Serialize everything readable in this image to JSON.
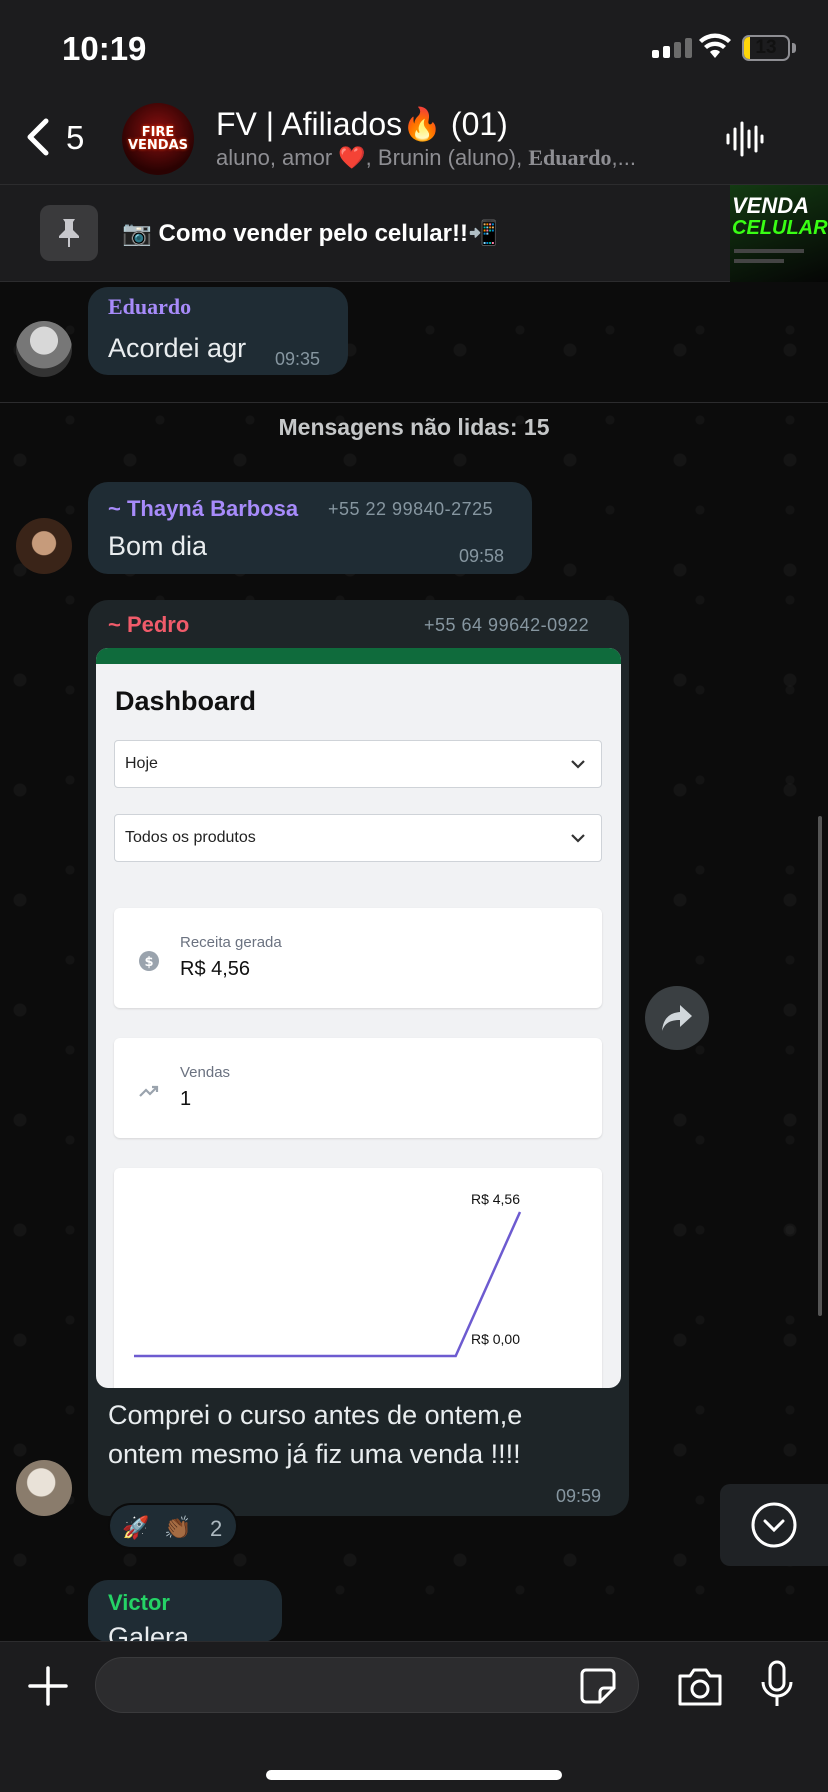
{
  "status_bar": {
    "time": "10:19",
    "battery": "13",
    "battery_level": 0.13,
    "battery_color": "#ffd60a"
  },
  "header": {
    "back_count": "5",
    "avatar_text_1": "FIRE",
    "avatar_text_2": "VENDAS",
    "title": "FV | Afiliados🔥 (01)",
    "members_prefix": "aluno, amor ❤️, Brunin (aluno), ",
    "members_bold": "Eduardo",
    "members_suffix": ",..."
  },
  "pinned": {
    "text": "📷 Como vender pelo celular!!📲",
    "thumb_line1": "VENDA",
    "thumb_line2": "CELULAR"
  },
  "messages": {
    "eduardo": {
      "sender": "Eduardo",
      "text": "Acordei agr",
      "time": "09:35",
      "color": "#a78bfa"
    },
    "unread_label": "Mensagens não lidas: 15",
    "thayna": {
      "sender": "~ Thayná Barbosa",
      "phone": "+55 22 99840-2725",
      "text": "Bom dia",
      "time": "09:58",
      "color": "#a78bfa"
    },
    "pedro": {
      "sender": "~ Pedro",
      "phone": "+55 64 99642-0922",
      "text_line1": "Comprei o curso antes de ontem,e",
      "text_line2": "ontem mesmo já fiz uma venda !!!!",
      "time": "09:59",
      "color": "#f05b6a",
      "reactions": {
        "emoji_1": "🚀",
        "emoji_2": "👏🏾",
        "count": "2"
      }
    },
    "victor": {
      "sender": "Victor",
      "text_partial": "Galera",
      "color": "#25d366"
    }
  },
  "screenshot": {
    "title": "Dashboard",
    "filter_period": "Hoje",
    "filter_product": "Todos os produtos",
    "revenue_label": "Receita gerada",
    "revenue_value": "R$ 4,56",
    "sales_label": "Vendas",
    "sales_value": "1",
    "chart_data": {
      "type": "line",
      "tick_labels": [
        "R$ 4,56",
        "R$ 0,00"
      ],
      "ylim": [
        0,
        4.56
      ],
      "series": [
        {
          "values": [
            0,
            0,
            0,
            0,
            0,
            0,
            4.56
          ]
        }
      ],
      "color": "#6d5bd0"
    }
  },
  "input": {
    "placeholder": "",
    "value": ""
  },
  "colors": {
    "bubble": "#1f2c34",
    "accent_green": "#25d366"
  }
}
